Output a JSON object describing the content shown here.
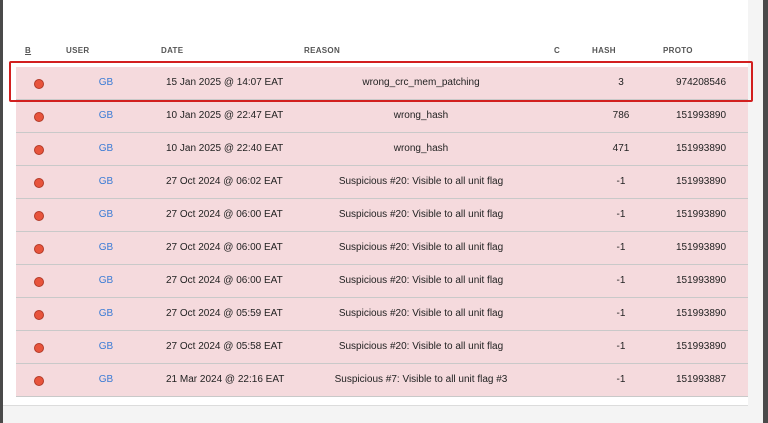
{
  "table": {
    "headers": {
      "b": "B",
      "user": "USER",
      "date": "DATE",
      "reason": "REASON",
      "c": "C",
      "hash": "HASH",
      "proto": "PROTO"
    },
    "rows": [
      {
        "user": "GB",
        "date": "15 Jan 2025 @ 14:07 EAT",
        "reason": "wrong_crc_mem_patching",
        "count": "3",
        "proto": "974208546"
      },
      {
        "user": "GB",
        "date": "10 Jan 2025 @ 22:47 EAT",
        "reason": "wrong_hash",
        "count": "786",
        "proto": "151993890"
      },
      {
        "user": "GB",
        "date": "10 Jan 2025 @ 22:40 EAT",
        "reason": "wrong_hash",
        "count": "471",
        "proto": "151993890"
      },
      {
        "user": "GB",
        "date": "27 Oct 2024 @ 06:02 EAT",
        "reason": "Suspicious #20: Visible to all unit flag",
        "count": "-1",
        "proto": "151993890"
      },
      {
        "user": "GB",
        "date": "27 Oct 2024 @ 06:00 EAT",
        "reason": "Suspicious #20: Visible to all unit flag",
        "count": "-1",
        "proto": "151993890"
      },
      {
        "user": "GB",
        "date": "27 Oct 2024 @ 06:00 EAT",
        "reason": "Suspicious #20: Visible to all unit flag",
        "count": "-1",
        "proto": "151993890"
      },
      {
        "user": "GB",
        "date": "27 Oct 2024 @ 06:00 EAT",
        "reason": "Suspicious #20: Visible to all unit flag",
        "count": "-1",
        "proto": "151993890"
      },
      {
        "user": "GB",
        "date": "27 Oct 2024 @ 05:59 EAT",
        "reason": "Suspicious #20: Visible to all unit flag",
        "count": "-1",
        "proto": "151993890"
      },
      {
        "user": "GB",
        "date": "27 Oct 2024 @ 05:58 EAT",
        "reason": "Suspicious #20: Visible to all unit flag",
        "count": "-1",
        "proto": "151993890"
      },
      {
        "user": "GB",
        "date": "21 Mar 2024 @ 22:16 EAT",
        "reason": "Suspicious #7: Visible to all unit flag #3",
        "count": "-1",
        "proto": "151993887"
      }
    ]
  },
  "colors": {
    "row_background": "#f5dadd",
    "status_dot": "#e8543c",
    "user_link": "#3a7bd5",
    "highlight_border": "#d21f1f"
  },
  "icons": {
    "status": "red-circle-icon"
  }
}
